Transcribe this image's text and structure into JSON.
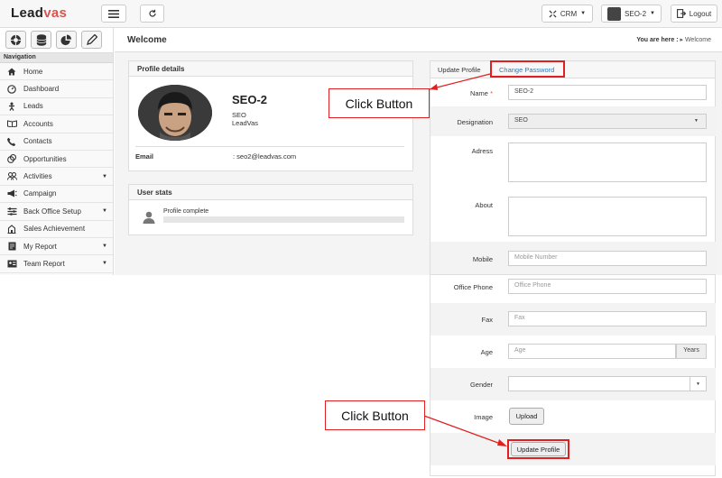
{
  "header": {
    "logo_main": "Lead",
    "logo_accent": "vas",
    "crm_label": "CRM",
    "user_label": "SEO-2",
    "logout_label": "Logout"
  },
  "sidebar": {
    "nav_heading": "Navigation",
    "items": [
      {
        "label": "Home",
        "icon": "home-icon"
      },
      {
        "label": "Dashboard",
        "icon": "dashboard-icon"
      },
      {
        "label": "Leads",
        "icon": "leads-icon"
      },
      {
        "label": "Accounts",
        "icon": "accounts-icon"
      },
      {
        "label": "Contacts",
        "icon": "phone-icon"
      },
      {
        "label": "Opportunities",
        "icon": "coins-icon"
      },
      {
        "label": "Activities",
        "icon": "users-icon",
        "has_submenu": true
      },
      {
        "label": "Campaign",
        "icon": "megaphone-icon"
      },
      {
        "label": "Back Office Setup",
        "icon": "setup-icon",
        "has_submenu": true
      },
      {
        "label": "Sales Achievement",
        "icon": "building-icon"
      },
      {
        "label": "My Report",
        "icon": "report-icon",
        "has_submenu": true
      },
      {
        "label": "Team Report",
        "icon": "team-report-icon",
        "has_submenu": true
      }
    ]
  },
  "page": {
    "title": "Welcome",
    "breadcrumb_prefix": "You are here :",
    "breadcrumb_current": "Welcome"
  },
  "profile": {
    "panel_title": "Profile details",
    "name": "SEO-2",
    "role": "SEO",
    "company": "LeadVas",
    "email_label": "Email",
    "email_value": ": seo2@leadvas.com"
  },
  "stats": {
    "panel_title": "User stats",
    "progress_label": "Profile complete",
    "progress_fraction": 0
  },
  "form": {
    "tabs": [
      "Update Profile",
      "Change Password"
    ],
    "active_tab": "Update Profile",
    "name_label": "Name",
    "required_mark": "*",
    "name_value": "SEO-2",
    "designation_label": "Designation",
    "designation_value": "SEO",
    "address_label": "Adress",
    "about_label": "About",
    "mobile_label": "Mobile",
    "mobile_placeholder": "Mobile Number",
    "office_label": "Office Phone",
    "office_placeholder": "Office Phone",
    "fax_label": "Fax",
    "fax_placeholder": "Fax",
    "age_label": "Age",
    "age_placeholder": "Age",
    "age_suffix": "Years",
    "gender_label": "Gender",
    "image_label": "Image",
    "upload_label": "Upload",
    "submit_label": "Update Profile"
  },
  "annotations": {
    "callout_top": "Click Button",
    "callout_bottom": "Click Button",
    "highlight_color": "#e02020"
  }
}
